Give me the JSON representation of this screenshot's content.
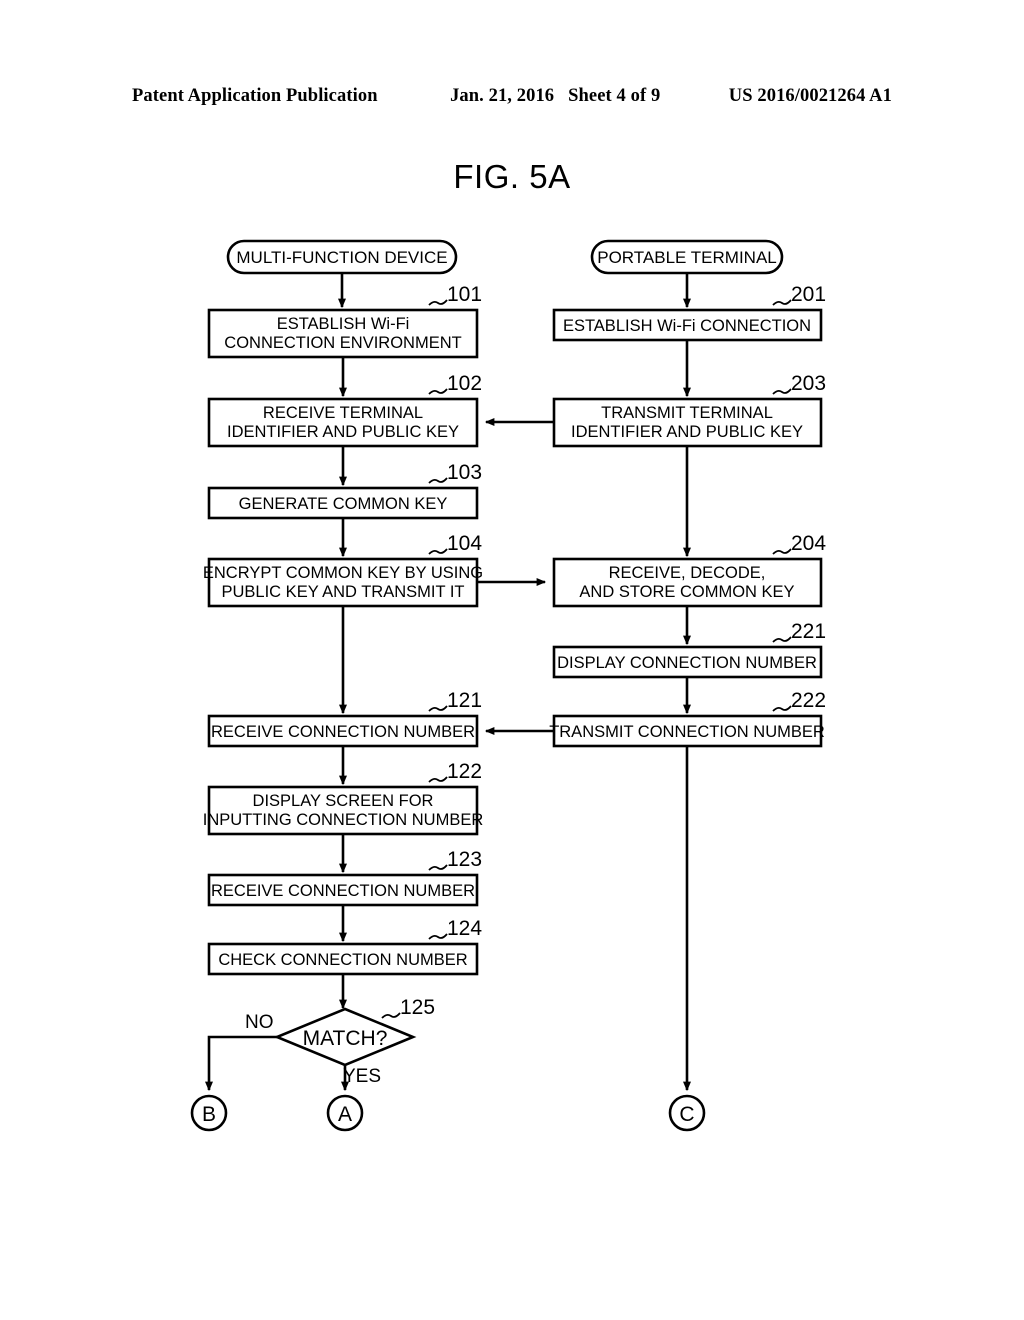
{
  "header": {
    "left": "Patent Application Publication",
    "date": "Jan. 21, 2016",
    "sheet": "Sheet 4 of 9",
    "pubnum": "US 2016/0021264 A1"
  },
  "figure": {
    "title": "FIG. 5A"
  },
  "colors": {
    "ink": "#000000",
    "paper": "#ffffff"
  },
  "lanes": [
    {
      "id": "left",
      "terminator": "MULTI-FUNCTION DEVICE"
    },
    {
      "id": "right",
      "terminator": "PORTABLE TERMINAL"
    }
  ],
  "left_steps": [
    {
      "ref": "101",
      "lines": [
        "ESTABLISH Wi-Fi",
        "CONNECTION ENVIRONMENT"
      ]
    },
    {
      "ref": "102",
      "lines": [
        "RECEIVE TERMINAL",
        "IDENTIFIER AND PUBLIC KEY"
      ]
    },
    {
      "ref": "103",
      "lines": [
        "GENERATE COMMON KEY"
      ]
    },
    {
      "ref": "104",
      "lines": [
        "ENCRYPT COMMON KEY BY USING",
        "PUBLIC KEY AND TRANSMIT IT"
      ]
    },
    {
      "ref": "121",
      "lines": [
        "RECEIVE CONNECTION NUMBER"
      ]
    },
    {
      "ref": "122",
      "lines": [
        "DISPLAY SCREEN FOR",
        "INPUTTING CONNECTION NUMBER"
      ]
    },
    {
      "ref": "123",
      "lines": [
        "RECEIVE CONNECTION NUMBER"
      ]
    },
    {
      "ref": "124",
      "lines": [
        "CHECK CONNECTION NUMBER"
      ]
    }
  ],
  "right_steps": [
    {
      "ref": "201",
      "lines": [
        "ESTABLISH Wi-Fi CONNECTION"
      ]
    },
    {
      "ref": "203",
      "lines": [
        "TRANSMIT TERMINAL",
        "IDENTIFIER AND PUBLIC KEY"
      ]
    },
    {
      "ref": "204",
      "lines": [
        "RECEIVE, DECODE,",
        "AND STORE COMMON KEY"
      ]
    },
    {
      "ref": "221",
      "lines": [
        "DISPLAY CONNECTION NUMBER"
      ]
    },
    {
      "ref": "222",
      "lines": [
        "TRANSMIT CONNECTION NUMBER"
      ]
    }
  ],
  "decision": {
    "ref": "125",
    "label": "MATCH?",
    "no_label": "NO",
    "yes_label": "YES"
  },
  "connectors": [
    {
      "id": "B",
      "label": "B"
    },
    {
      "id": "A",
      "label": "A"
    },
    {
      "id": "C",
      "label": "C"
    }
  ]
}
